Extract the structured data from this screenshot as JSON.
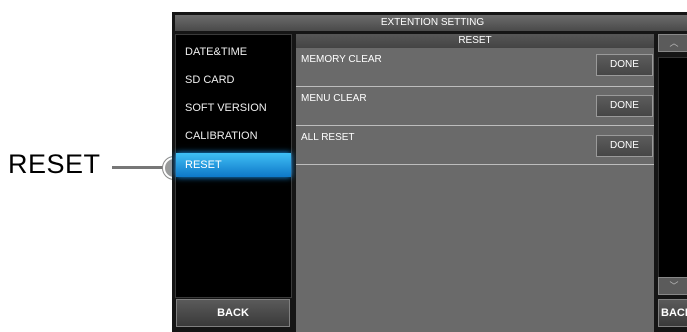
{
  "callout": {
    "label": "RESET"
  },
  "title": "EXTENTION SETTING",
  "sidebar": {
    "items": [
      {
        "label": "DATE&TIME"
      },
      {
        "label": "SD CARD"
      },
      {
        "label": "SOFT VERSION"
      },
      {
        "label": "CALIBRATION"
      },
      {
        "label": "RESET",
        "active": true
      }
    ],
    "back_label": "BACK"
  },
  "panel": {
    "title": "RESET",
    "rows": [
      {
        "label": "MEMORY CLEAR",
        "button": "DONE"
      },
      {
        "label": "MENU CLEAR",
        "button": "DONE"
      },
      {
        "label": "ALL RESET",
        "button": "DONE"
      }
    ]
  },
  "right": {
    "scroll_up": "︿",
    "scroll_down": "﹀",
    "back_label": "BACK"
  },
  "colors": {
    "active_item": "#1aa0ff",
    "panel_bg": "#6a6a6a"
  }
}
